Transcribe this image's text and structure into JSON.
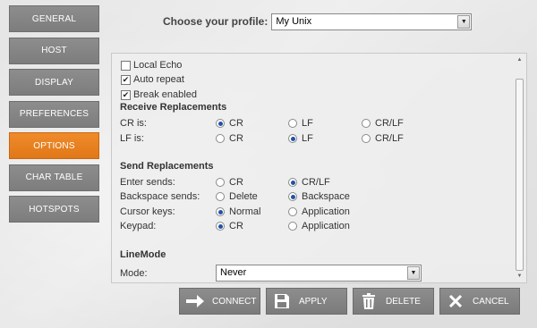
{
  "sidebar": {
    "items": [
      {
        "label": "GENERAL"
      },
      {
        "label": "HOST"
      },
      {
        "label": "DISPLAY"
      },
      {
        "label": "PREFERENCES"
      },
      {
        "label": "OPTIONS"
      },
      {
        "label": "CHAR TABLE"
      },
      {
        "label": "HOTSPOTS"
      }
    ],
    "active": "OPTIONS"
  },
  "profile": {
    "label": "Choose your profile:",
    "value": "My Unix"
  },
  "options": {
    "checkboxes": [
      {
        "label": "Local Echo",
        "checked": false
      },
      {
        "label": "Auto repeat",
        "checked": true
      },
      {
        "label": "Break enabled",
        "checked": true
      }
    ],
    "receive": {
      "title": "Receive Replacements",
      "cr_label": "CR is:",
      "lf_label": "LF is:",
      "options": [
        "CR",
        "LF",
        "CR/LF"
      ],
      "cr_selected": "CR",
      "lf_selected": "LF"
    },
    "send": {
      "title": "Send Replacements",
      "enter_label": "Enter sends:",
      "enter_opts": [
        "CR",
        "CR/LF"
      ],
      "enter_selected": "CR/LF",
      "backspace_label": "Backspace sends:",
      "backspace_opts": [
        "Delete",
        "Backspace"
      ],
      "backspace_selected": "Backspace",
      "cursor_label": "Cursor keys:",
      "cursor_opts": [
        "Normal",
        "Application"
      ],
      "cursor_selected": "Normal",
      "keypad_label": "Keypad:",
      "keypad_opts": [
        "CR",
        "Application"
      ],
      "keypad_selected": "CR"
    },
    "linemode": {
      "title": "LineMode",
      "mode_label": "Mode:",
      "mode_value": "Never"
    }
  },
  "buttons": {
    "connect": "CONNECT",
    "apply": "APPLY",
    "delete": "DELETE",
    "cancel": "CANCEL"
  },
  "colors": {
    "accent": "#f08a2a",
    "nav": "#848484",
    "radio_on": "#2451a6"
  }
}
